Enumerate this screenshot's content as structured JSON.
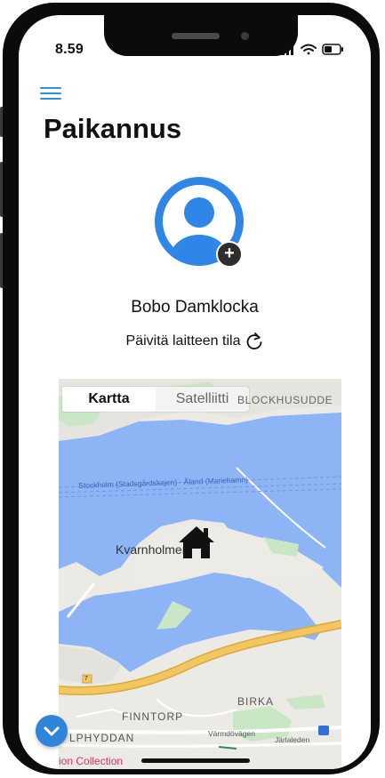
{
  "status_bar": {
    "time": "8.59"
  },
  "header": {
    "menu_icon": "hamburger-menu-icon",
    "title": "Paikannus"
  },
  "profile": {
    "avatar_icon": "user-avatar-icon",
    "add_icon": "add-photo-icon",
    "add_symbol": "+",
    "name": "Bobo Damklocka",
    "refresh_label": "Päivitä laitteen tila",
    "refresh_icon": "refresh-icon"
  },
  "map": {
    "tabs": [
      {
        "label": "Kartta",
        "active": true
      },
      {
        "label": "Satelliitti",
        "active": false
      }
    ],
    "marker_icon": "home-icon",
    "labels": {
      "blockhusudde": "BLOCKHUSUDDE",
      "ferry_route": "Stockholm (Stadsgårdskajen) - Åland (Mariehamn)",
      "kvarnholmen": "Kvarnholmen",
      "birka": "BIRKA",
      "finntorp": "FINNTORP",
      "lphyddan": "LPHYDDAN",
      "varmdovagen": "Värmdövägen",
      "jarlaleden": "Järlaleden",
      "road_number": "7",
      "collection": "ion Collection"
    }
  },
  "fab": {
    "icon": "chevron-down-icon"
  },
  "colors": {
    "accent": "#2f86d8",
    "water": "#8db4f5",
    "park": "#c9e6c5",
    "road": "#f3c760"
  }
}
